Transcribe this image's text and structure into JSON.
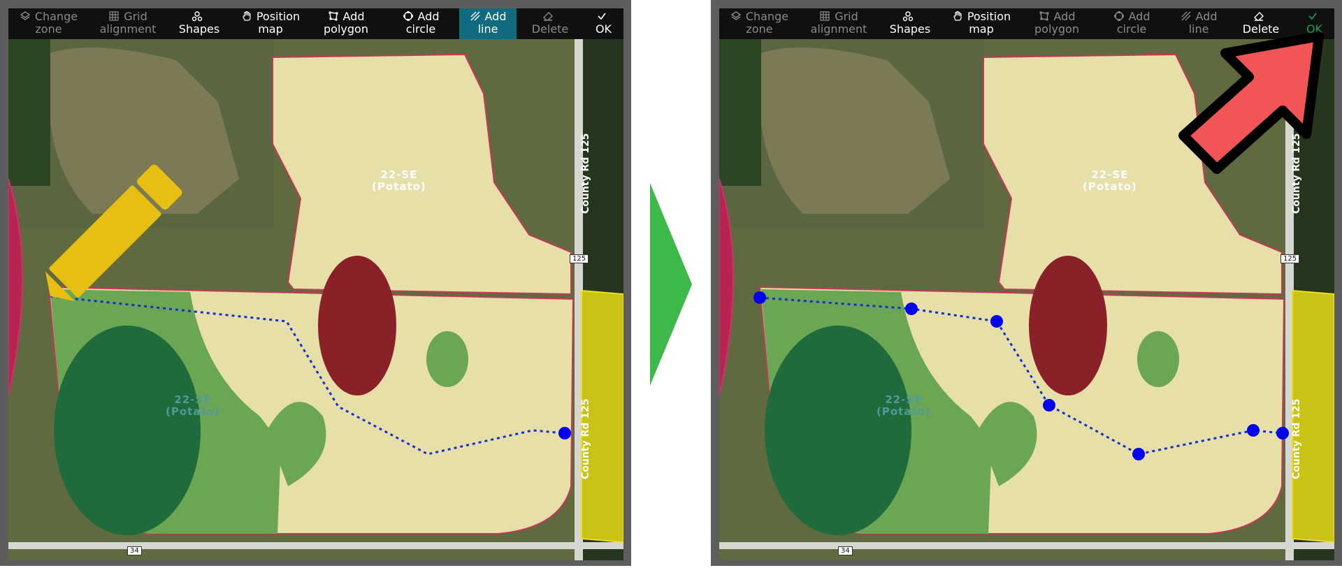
{
  "left": {
    "toolbar": [
      {
        "name": "change-zone-button",
        "icon": "layers-icon",
        "line1": "Change",
        "line2": "zone",
        "state": "dim"
      },
      {
        "name": "grid-alignment-button",
        "icon": "grid-icon",
        "line1": "Grid",
        "line2": "alignment",
        "state": "dim"
      },
      {
        "name": "shapes-button",
        "icon": "shapes-icon",
        "line1": "",
        "line2": "Shapes",
        "state": "bright"
      },
      {
        "name": "position-map-button",
        "icon": "hand-icon",
        "line1": "Position",
        "line2": "map",
        "state": "bright"
      },
      {
        "name": "add-polygon-button",
        "icon": "polygon-icon",
        "line1": "Add",
        "line2": "polygon",
        "state": "bright"
      },
      {
        "name": "add-circle-button",
        "icon": "circle-icon",
        "line1": "Add",
        "line2": "circle",
        "state": "bright"
      },
      {
        "name": "add-line-button",
        "icon": "line-icon",
        "line1": "Add",
        "line2": "line",
        "state": "active"
      },
      {
        "name": "delete-button",
        "icon": "eraser-icon",
        "line1": "",
        "line2": "Delete",
        "state": "dim"
      },
      {
        "name": "ok-button",
        "icon": "check-icon",
        "line1": "",
        "line2": "OK",
        "state": "bright"
      }
    ],
    "zone_top_label": {
      "line1": "22-SE",
      "line2": "(Potato)"
    },
    "zone_bottom_label": {
      "line1": "22-SE",
      "line2": "(Potato)"
    },
    "road_vertical_top": "County Rd 125",
    "road_vertical_bottom": "County Rd 125",
    "shield_125": "125",
    "shield_34": "34"
  },
  "right": {
    "toolbar": [
      {
        "name": "change-zone-button",
        "icon": "layers-icon",
        "line1": "Change",
        "line2": "zone",
        "state": "dim"
      },
      {
        "name": "grid-alignment-button",
        "icon": "grid-icon",
        "line1": "Grid",
        "line2": "alignment",
        "state": "dim"
      },
      {
        "name": "shapes-button",
        "icon": "shapes-icon",
        "line1": "",
        "line2": "Shapes",
        "state": "bright"
      },
      {
        "name": "position-map-button",
        "icon": "hand-icon",
        "line1": "Position",
        "line2": "map",
        "state": "bright"
      },
      {
        "name": "add-polygon-button",
        "icon": "polygon-icon",
        "line1": "Add",
        "line2": "polygon",
        "state": "dim"
      },
      {
        "name": "add-circle-button",
        "icon": "circle-icon",
        "line1": "Add",
        "line2": "circle",
        "state": "dim"
      },
      {
        "name": "add-line-button",
        "icon": "line-icon",
        "line1": "Add",
        "line2": "line",
        "state": "dim"
      },
      {
        "name": "delete-button",
        "icon": "eraser-icon",
        "line1": "",
        "line2": "Delete",
        "state": "bright"
      },
      {
        "name": "ok-button",
        "icon": "check-icon",
        "line1": "",
        "line2": "OK",
        "state": "okdim"
      }
    ],
    "zone_top_label": {
      "line1": "22-SE",
      "line2": "(Potato)"
    },
    "zone_bottom_label": {
      "line1": "22-SE",
      "line2": "(Potato)"
    },
    "road_vertical_top": "County Rd 125",
    "road_vertical_bottom": "County Rd 125",
    "shield_125": "125",
    "shield_34": "34"
  },
  "colors": {
    "toolbar_bg": "#0e110e",
    "active_tool_bg": "#0f6b7d",
    "pencil": "#e6bf12",
    "pointer_arrow": "#f25555",
    "next_arrow": "#3db84a",
    "line_vertex": "#0000ee",
    "zone_red": "#8a2128",
    "zone_dark_green": "#1f6b3b",
    "zone_green": "#5a9c45",
    "zone_cream": "#e7dfa8",
    "zone_yellow": "#c9c316"
  }
}
